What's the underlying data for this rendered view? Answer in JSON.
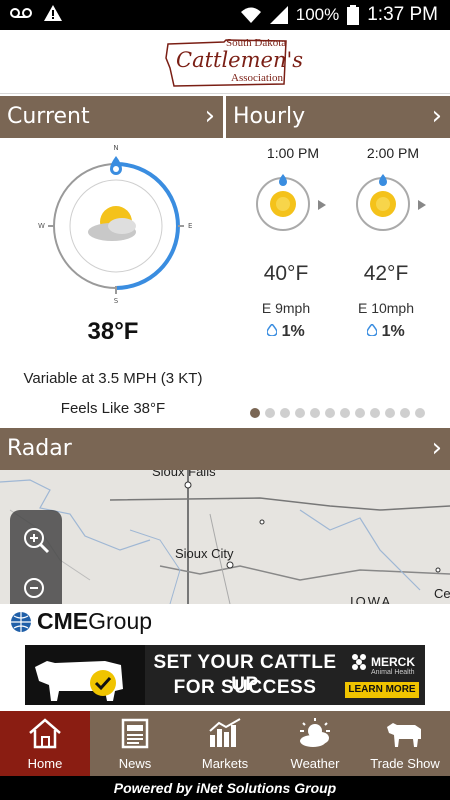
{
  "status_bar": {
    "battery": "100%",
    "time": "1:37 PM"
  },
  "logo": {
    "line1": "South Dakota",
    "line2": "Cattlemen's",
    "line3": "Association"
  },
  "current": {
    "header": "Current",
    "compass": {
      "n": "N",
      "e": "E",
      "s": "S",
      "w": "W"
    },
    "temperature": "38°F",
    "wind": "Variable at 3.5 MPH (3 KT)",
    "feels_like": "Feels Like 38°F"
  },
  "hourly": {
    "header": "Hourly",
    "items": [
      {
        "time": "1:00 PM",
        "temp": "40°F",
        "wind": "E 9mph",
        "precip": "1%"
      },
      {
        "time": "2:00 PM",
        "temp": "42°F",
        "wind": "E 10mph",
        "precip": "1%"
      }
    ],
    "pager_count": 12,
    "pager_active": 0
  },
  "radar": {
    "header": "Radar",
    "cities": [
      "Sioux Falls",
      "Sioux City",
      "IOWA",
      "Ce"
    ]
  },
  "sponsor": {
    "brand_bold": "CME",
    "brand_rest": "Group"
  },
  "ad": {
    "line1": "SET YOUR CATTLE UP",
    "line2": "FOR SUCCESS",
    "brand": "MERCK",
    "sub": "Animal Health",
    "cta": "LEARN MORE"
  },
  "tabs": [
    {
      "label": "Home",
      "icon": "home-icon",
      "active": true
    },
    {
      "label": "News",
      "icon": "newspaper-icon",
      "active": false
    },
    {
      "label": "Markets",
      "icon": "bar-chart-icon",
      "active": false
    },
    {
      "label": "Weather",
      "icon": "sun-cloud-icon",
      "active": false
    },
    {
      "label": "Trade Show",
      "icon": "cow-icon",
      "active": false
    }
  ],
  "footer": "Powered by iNet Solutions Group",
  "colors": {
    "brown": "#7a6654",
    "active_tab": "#8a1d12",
    "compass_blue": "#3a8de0"
  }
}
